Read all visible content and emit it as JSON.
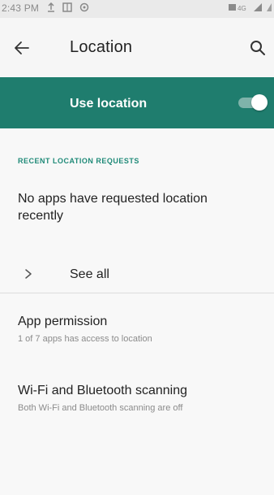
{
  "status_bar": {
    "time": "2:43 PM",
    "network": "4G",
    "left_icons": [
      "upload-icon",
      "photo-icon",
      "sync-icon"
    ],
    "right_icons": [
      "network-4g-icon",
      "signal-icon",
      "battery-icon"
    ]
  },
  "toolbar": {
    "title": "Location",
    "back_icon": "arrow-left-icon",
    "search_icon": "search-icon"
  },
  "master_switch": {
    "label": "Use location",
    "checked": true,
    "background_color": "#1f7d6e"
  },
  "recent_requests": {
    "header": "RECENT LOCATION REQUESTS",
    "empty_text": "No apps have requested location recently",
    "see_all_label": "See all"
  },
  "preferences": [
    {
      "title": "App permission",
      "summary": "1 of 7 apps has access to location"
    },
    {
      "title": "Wi-Fi and Bluetooth scanning",
      "summary": "Both Wi-Fi and Bluetooth scanning are off"
    }
  ],
  "colors": {
    "accent": "#1f8a78",
    "primary_text": "#222222",
    "secondary_text": "#8b8b8b"
  }
}
